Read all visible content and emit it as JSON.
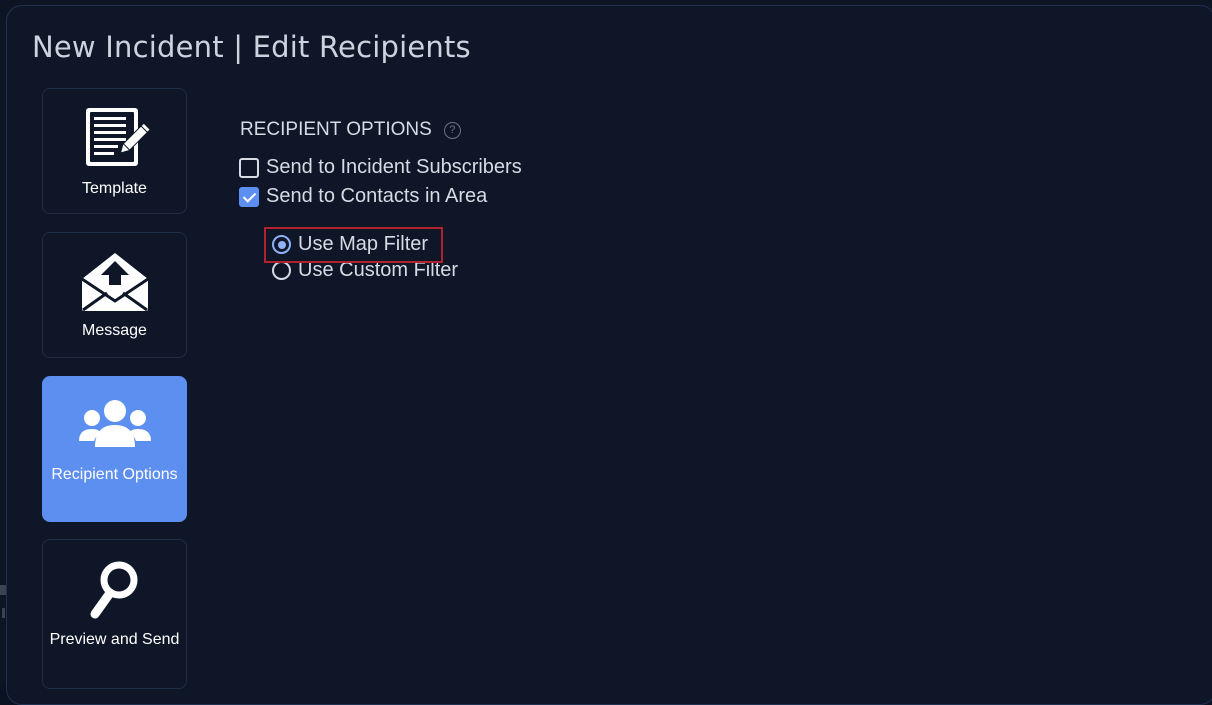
{
  "modal": {
    "title": "New Incident | Edit Recipients"
  },
  "sidebar": {
    "items": [
      {
        "label": "Template",
        "icon": "document-edit-icon",
        "active": false
      },
      {
        "label": "Message",
        "icon": "envelope-upload-icon",
        "active": false
      },
      {
        "label": "Recipient Options",
        "icon": "users-group-icon",
        "active": true
      },
      {
        "label": "Preview and Send",
        "icon": "magnifier-icon",
        "active": false
      }
    ]
  },
  "recipient_options": {
    "heading": "RECIPIENT OPTIONS",
    "help_glyph": "?",
    "checkboxes": [
      {
        "label": "Send to Incident Subscribers",
        "checked": false
      },
      {
        "label": "Send to Contacts in Area",
        "checked": true
      }
    ],
    "filter_radios": [
      {
        "label": "Use Map Filter",
        "selected": true
      },
      {
        "label": "Use Custom Filter",
        "selected": false
      }
    ]
  },
  "colors": {
    "accent": "#5c8ff0",
    "background": "#0e1627",
    "highlight": "#b3212e"
  }
}
